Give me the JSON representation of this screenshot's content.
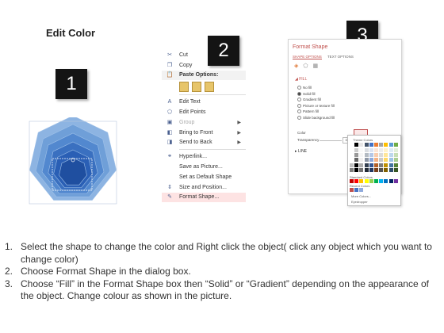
{
  "title": "Edit Color",
  "steps": [
    "1",
    "2",
    "3"
  ],
  "context_menu": {
    "items": [
      {
        "label": "Cut",
        "icon": "scissors-icon",
        "glyph": "✂",
        "disabled": false,
        "submenu": false
      },
      {
        "label": "Copy",
        "icon": "copy-icon",
        "glyph": "❐",
        "disabled": false,
        "submenu": false
      },
      {
        "label": "Paste Options:",
        "icon": "paste-icon",
        "glyph": "📋",
        "disabled": false,
        "submenu": false,
        "header": true
      },
      {
        "label": "Edit Text",
        "icon": "edit-text-icon",
        "glyph": "A",
        "disabled": false,
        "submenu": false
      },
      {
        "label": "Edit Points",
        "icon": "edit-points-icon",
        "glyph": "⬠",
        "disabled": false,
        "submenu": false
      },
      {
        "label": "Group",
        "icon": "group-icon",
        "glyph": "▣",
        "disabled": true,
        "submenu": true
      },
      {
        "label": "Bring to Front",
        "icon": "bring-to-front-icon",
        "glyph": "◧",
        "disabled": false,
        "submenu": true
      },
      {
        "label": "Send to Back",
        "icon": "send-to-back-icon",
        "glyph": "◨",
        "disabled": false,
        "submenu": true
      },
      {
        "label": "Hyperlink...",
        "icon": "hyperlink-icon",
        "glyph": "⚭",
        "disabled": false,
        "submenu": false
      },
      {
        "label": "Save as Picture...",
        "icon": "",
        "glyph": "",
        "disabled": false,
        "submenu": false
      },
      {
        "label": "Set as Default Shape",
        "icon": "",
        "glyph": "",
        "disabled": false,
        "submenu": false
      },
      {
        "label": "Size and Position...",
        "icon": "size-position-icon",
        "glyph": "⇕",
        "disabled": false,
        "submenu": false
      },
      {
        "label": "Format Shape...",
        "icon": "format-shape-icon",
        "glyph": "✎",
        "disabled": false,
        "submenu": false,
        "highlighted": true
      }
    ]
  },
  "format_panel": {
    "title": "Format Shape",
    "tabs": [
      "SHAPE OPTIONS",
      "TEXT OPTIONS"
    ],
    "fill_header": "FILL",
    "fill_options": [
      "No fill",
      "Solid fill",
      "Gradient fill",
      "Picture or texture fill",
      "Pattern fill",
      "Slide background fill"
    ],
    "color_label": "Color",
    "transparency_label": "Transparency",
    "transparency_value": "0%",
    "line_header": "LINE"
  },
  "palette": {
    "theme_label": "Theme Colors",
    "standard_label": "Standard Colors",
    "recent_label": "Recent Colors",
    "more_label": "More Colors...",
    "eyedropper_label": "Eyedropper",
    "theme_colors": [
      "#ffffff",
      "#000000",
      "#e7e6e6",
      "#44546a",
      "#4472c4",
      "#ed7d31",
      "#a5a5a5",
      "#ffc000",
      "#5b9bd5",
      "#70ad47"
    ],
    "standard_colors": [
      "#c00000",
      "#ff0000",
      "#ffc000",
      "#ffff00",
      "#92d050",
      "#00b050",
      "#00b0f0",
      "#0070c0",
      "#002060",
      "#7030a0"
    ],
    "recent_colors": [
      "#c0504d",
      "#4472c4",
      "#8faadc"
    ]
  },
  "shape_colors": [
    "#8db4e2",
    "#6f9fd8",
    "#5288cf",
    "#3a70c0",
    "#2a5fb5",
    "#1f4fa0"
  ],
  "instructions": [
    {
      "num": "1.",
      "text": "Select the shape to change the color and Right click the object( click any object which you want to change color)"
    },
    {
      "num": "2.",
      "text": "Choose Format Shape in the dialog box."
    },
    {
      "num": "3.",
      "text": "Choose “Fill” in the Format Shape box then “Solid” or “Gradient” depending on the appearance of the object. Change colour as shown in the picture."
    }
  ]
}
